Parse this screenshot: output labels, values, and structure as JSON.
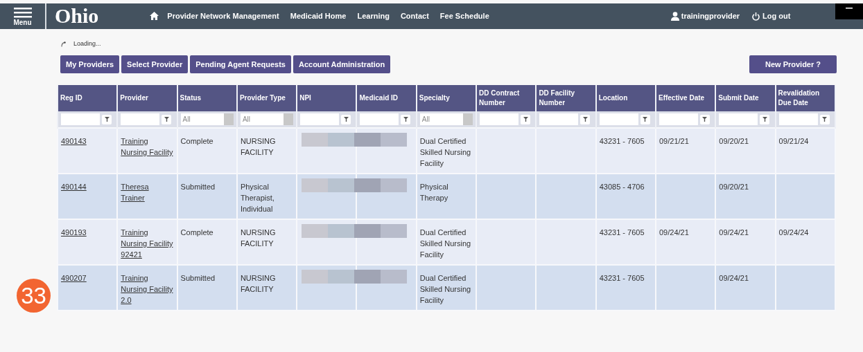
{
  "header": {
    "menu_label": "Menu",
    "logo": "Ohio",
    "nav": [
      "Provider Network Management",
      "Medicaid Home",
      "Learning",
      "Contact",
      "Fee Schedule"
    ],
    "user": "trainingprovider",
    "logout": "Log out"
  },
  "loading": "Loading...",
  "tabs": [
    {
      "label": "My Providers"
    },
    {
      "label": "Select Provider"
    },
    {
      "label": "Pending Agent Requests"
    },
    {
      "label": "Account Administration"
    }
  ],
  "new_provider": "New Provider ?",
  "table": {
    "columns": [
      {
        "label": "Reg ID",
        "filter": {
          "kind": "text"
        }
      },
      {
        "label": "Provider",
        "filter": {
          "kind": "text"
        }
      },
      {
        "label": "Status",
        "filter": {
          "kind": "select",
          "value": "All"
        }
      },
      {
        "label": "Provider Type",
        "filter": {
          "kind": "select",
          "value": "All"
        }
      },
      {
        "label": "NPI",
        "filter": {
          "kind": "text"
        }
      },
      {
        "label": "Medicaid ID",
        "filter": {
          "kind": "text"
        }
      },
      {
        "label": "Specialty",
        "filter": {
          "kind": "select",
          "value": "All"
        }
      },
      {
        "label": "DD Contract Number",
        "filter": {
          "kind": "text"
        }
      },
      {
        "label": "DD Facility Number",
        "filter": {
          "kind": "text"
        }
      },
      {
        "label": "Location",
        "filter": {
          "kind": "text"
        }
      },
      {
        "label": "Effective Date",
        "filter": {
          "kind": "text"
        }
      },
      {
        "label": "Submit Date",
        "filter": {
          "kind": "text"
        }
      },
      {
        "label": "Revalidation Due Date",
        "filter": {
          "kind": "text"
        }
      }
    ],
    "rows": [
      {
        "reg_id": "490143",
        "provider": "Training Nursing Facility",
        "status": "Complete",
        "provider_type": "NURSING FACILITY",
        "redacted": true,
        "specialty": "Dual Certified Skilled Nursing Facility",
        "location": "43231 - 7605",
        "effective_date": "09/21/21",
        "submit_date": "09/20/21",
        "revalidation_due_date": "09/21/24"
      },
      {
        "reg_id": "490144",
        "provider": "Theresa Trainer",
        "status": "Submitted",
        "provider_type": "Physical Therapist, Individual",
        "redacted": true,
        "specialty": "Physical Therapy",
        "location": "43085 - 4706",
        "submit_date": "09/20/21"
      },
      {
        "reg_id": "490193",
        "provider": "Training Nursing Facility 92421",
        "status": "Complete",
        "provider_type": "NURSING FACILITY",
        "redacted": true,
        "specialty": "Dual Certified Skilled Nursing Facility",
        "location": "43231 - 7605",
        "effective_date": "09/24/21",
        "submit_date": "09/24/21",
        "revalidation_due_date": "09/24/24"
      },
      {
        "reg_id": "490207",
        "provider": "Training Nursing Facility 2.0",
        "status": "Submitted",
        "provider_type": "NURSING FACILITY",
        "redacted": true,
        "specialty": "Dual Certified Skilled Nursing Facility",
        "location": "43231 - 7605",
        "submit_date": "09/24/21"
      }
    ]
  },
  "step_badge": "33"
}
